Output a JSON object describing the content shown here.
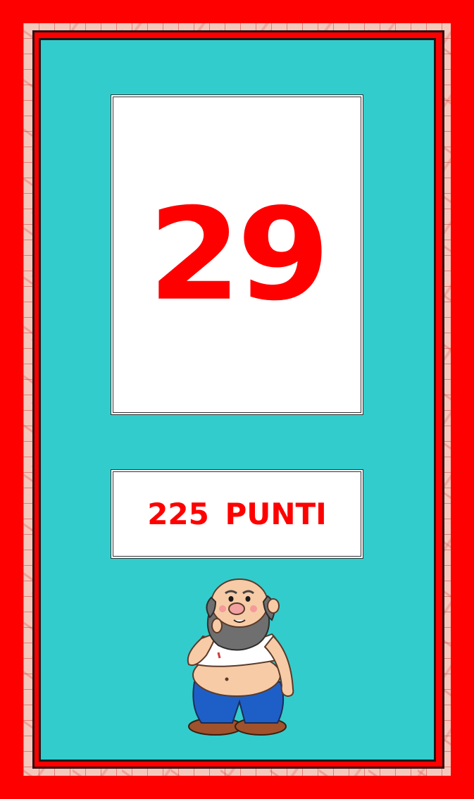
{
  "card": {
    "number": "29",
    "points_label": "225 PUNTI"
  },
  "character": {
    "icon": "bearded-old-man-illustration"
  },
  "colors": {
    "frame": "#ff0000",
    "panel": "#33cccc",
    "text": "#ff0000",
    "box": "#ffffff"
  }
}
